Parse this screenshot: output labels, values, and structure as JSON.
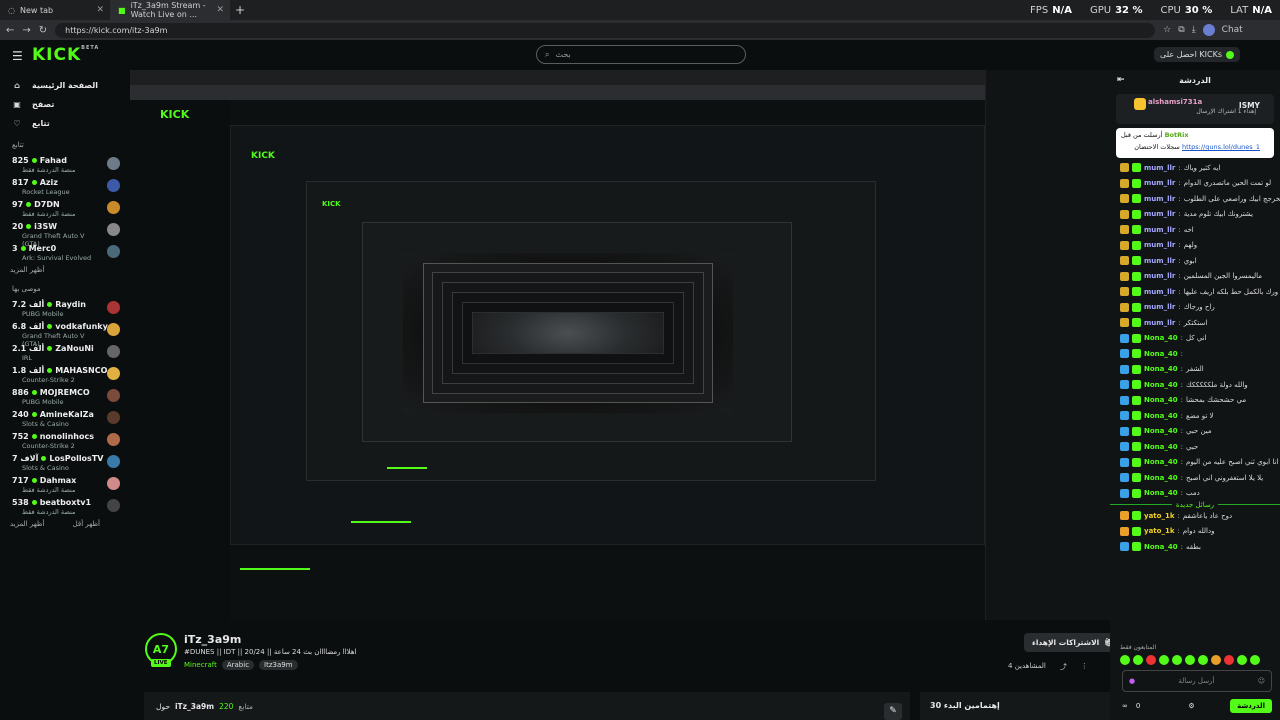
{
  "browser": {
    "tabs": [
      {
        "label": "New tab"
      },
      {
        "label": "iTz_3a9m Stream - Watch Live on ..."
      }
    ],
    "perf": [
      {
        "label": "FPS",
        "value": "N/A"
      },
      {
        "label": "GPU",
        "value": "32 %"
      },
      {
        "label": "CPU",
        "value": "30 %"
      },
      {
        "label": "LAT",
        "value": "N/A"
      }
    ],
    "url": "https://kick.com/itz-3a9m",
    "profile": "Chat"
  },
  "header": {
    "logo": "KICK",
    "logo_beta": "BETA",
    "search_placeholder": "بحث",
    "get_kicks": "احصل على KICKs"
  },
  "sidebar": {
    "nav": [
      {
        "label": "الصفحة الرئيسية",
        "icon": "home-icon"
      },
      {
        "label": "تصفح",
        "icon": "browse-icon"
      },
      {
        "label": "تتابع",
        "icon": "heart-icon"
      }
    ],
    "following_title": "تتابع",
    "following": [
      {
        "count": "825",
        "name": "Fahad",
        "game": "منصة الدردشة فقط",
        "color": "#6c7a89"
      },
      {
        "count": "817",
        "name": "Aziz",
        "game": "Rocket League",
        "color": "#3c5aa8"
      },
      {
        "count": "97",
        "name": "D7DN",
        "game": "منصة الدردشة فقط",
        "color": "#c98b2a"
      },
      {
        "count": "20",
        "name": "i3SW",
        "game": "Grand Theft Auto V (GTA)",
        "color": "#888"
      },
      {
        "count": "3",
        "name": "Merc0",
        "game": "Ark: Survival Evolved",
        "color": "#4a6a7a"
      }
    ],
    "show_more": "أظهر المزيد",
    "recommended_title": "موصى بها",
    "recommended": [
      {
        "count": "7.2 ألف",
        "name": "Raydin",
        "game": "PUBG Mobile",
        "color": "#a33"
      },
      {
        "count": "6.8 ألف",
        "name": "vodkafunky",
        "game": "Grand Theft Auto V (GTA)",
        "color": "#d9a43a"
      },
      {
        "count": "2.1 ألف",
        "name": "ZaNouNi",
        "game": "IRL",
        "color": "#666"
      },
      {
        "count": "1.8 ألف",
        "name": "MAHASNCO",
        "game": "Counter-Strike 2",
        "color": "#e0b040"
      },
      {
        "count": "886",
        "name": "MOJREMCO",
        "game": "PUBG Mobile",
        "color": "#7a4a3a"
      },
      {
        "count": "240",
        "name": "AmineKaIZa",
        "game": "Slots & Casino",
        "color": "#5a3a2a"
      },
      {
        "count": "752",
        "name": "nonolinhocs",
        "game": "Counter-Strike 2",
        "color": "#b06a4a"
      },
      {
        "count": "7 آلاف",
        "name": "LosPollosTV",
        "game": "Slots & Casino",
        "color": "#3a7aa8"
      },
      {
        "count": "717",
        "name": "Dahmax",
        "game": "منصة الدردشة فقط",
        "color": "#d08a8a"
      },
      {
        "count": "538",
        "name": "beatboxtv1",
        "game": "منصة الدردشة فقط",
        "color": "#444"
      }
    ],
    "show_more2": "أظهر المزيد",
    "show_less": "أظهر أقل"
  },
  "stream": {
    "avatar_text": "A7",
    "live": "LIVE",
    "streamer": "iTz_3a9m",
    "title": "#DUNES || IDT || 20/24 || اهلااا رمضاااان بث 24 ساعة",
    "category": "Minecraft",
    "tags": [
      "Arabic",
      "Itz3a9m"
    ],
    "subscribe": "الاشتراكات الإهداء",
    "viewers": "المشاهدين 4",
    "about_prefix": "حول",
    "about_name": "iTz_3a9m",
    "about_count": "220",
    "about_suffix": "متابع",
    "recent": "إهتمامين البدء 30"
  },
  "chat": {
    "title": "الدردشة",
    "top_user": {
      "name": "alshamsi731a",
      "rank": "ISMY",
      "note": "إهداء 1 اشتراك الإرسال",
      "sub": "3"
    },
    "pinned": {
      "user": "BotRix",
      "prefix": "أرسلت من قبل",
      "text": "سجلات الاحتضان",
      "link": "https://guns.lol/dunes_1"
    },
    "messages": [
      {
        "user": "mum_llr",
        "text": "ايه كثير وياك",
        "c": "u-nm",
        "b": "b-y"
      },
      {
        "user": "mum_llr",
        "text": "لو تمت الحين ماتصدري الدوام",
        "c": "u-nm",
        "b": "b-y"
      },
      {
        "user": "mum_llr",
        "text": "بعد مخرجج ابيك وراصعي على الطلوب",
        "c": "u-nm",
        "b": "b-y"
      },
      {
        "user": "mum_llr",
        "text": "يشترونك ابيك تلوم مدية",
        "c": "u-nm",
        "b": "b-y"
      },
      {
        "user": "mum_llr",
        "text": "اخه",
        "c": "u-nm",
        "b": "b-y"
      },
      {
        "user": "mum_llr",
        "text": "ولهم",
        "c": "u-nm",
        "b": "b-y"
      },
      {
        "user": "mum_llr",
        "text": "ابوي",
        "c": "u-nm",
        "b": "b-y"
      },
      {
        "user": "mum_llr",
        "text": "ماليمسروا الجين المسلمين",
        "c": "u-nm",
        "b": "b-y"
      },
      {
        "user": "mum_llr",
        "text": "ورك بالكمل حط بلكه اريف عليها",
        "c": "u-nm",
        "b": "b-y"
      },
      {
        "user": "mum_llr",
        "text": "راح ورجاك",
        "c": "u-nm",
        "b": "b-y"
      },
      {
        "user": "mum_llr",
        "text": "استكتكر",
        "c": "u-nm",
        "b": "b-y"
      },
      {
        "user": "Nona_40",
        "text": "اني كل",
        "c": "u-no",
        "b": "b-b"
      },
      {
        "user": "Nona_40",
        "text": "",
        "c": "u-no",
        "b": "b-b"
      },
      {
        "user": "Nona_40",
        "text": "الشفر",
        "c": "u-no",
        "b": "b-b"
      },
      {
        "user": "Nona_40",
        "text": "والله دولة ملكككككك",
        "c": "u-no",
        "b": "b-b"
      },
      {
        "user": "Nona_40",
        "text": "مي حشحشك بمحشا",
        "c": "u-no",
        "b": "b-b"
      },
      {
        "user": "Nona_40",
        "text": "لا تو مضع",
        "c": "u-no",
        "b": "b-b"
      },
      {
        "user": "Nona_40",
        "text": "مين حبي",
        "c": "u-no",
        "b": "b-b"
      },
      {
        "user": "Nona_40",
        "text": "حبي",
        "c": "u-no",
        "b": "b-b"
      },
      {
        "user": "Nona_40",
        "text": "انا ابوي ثني اصبح عليه من اليوم",
        "c": "u-no",
        "b": "b-b"
      },
      {
        "user": "Nona_40",
        "text": "يلا يلا استغفروني اني اصبح",
        "c": "u-no",
        "b": "b-b"
      },
      {
        "user": "Nona_40",
        "text": "دمب",
        "c": "u-no",
        "b": "b-b"
      }
    ],
    "new_messages": "رسائل جديدة",
    "messages2": [
      {
        "user": "yato_1k",
        "text": "دوح عاد ياعاشقم",
        "c": "u-ya",
        "b": "b-o"
      },
      {
        "user": "yato_1k",
        "text": "ودالله دوام",
        "c": "u-ya",
        "b": "b-o"
      },
      {
        "user": "Nona_40",
        "text": "بطقه",
        "c": "u-no",
        "b": "b-b"
      }
    ],
    "emotes_label": "المتابعون فقط",
    "input_placeholder": "أرسل رسالة",
    "points": "0",
    "send": "الدردشة"
  }
}
